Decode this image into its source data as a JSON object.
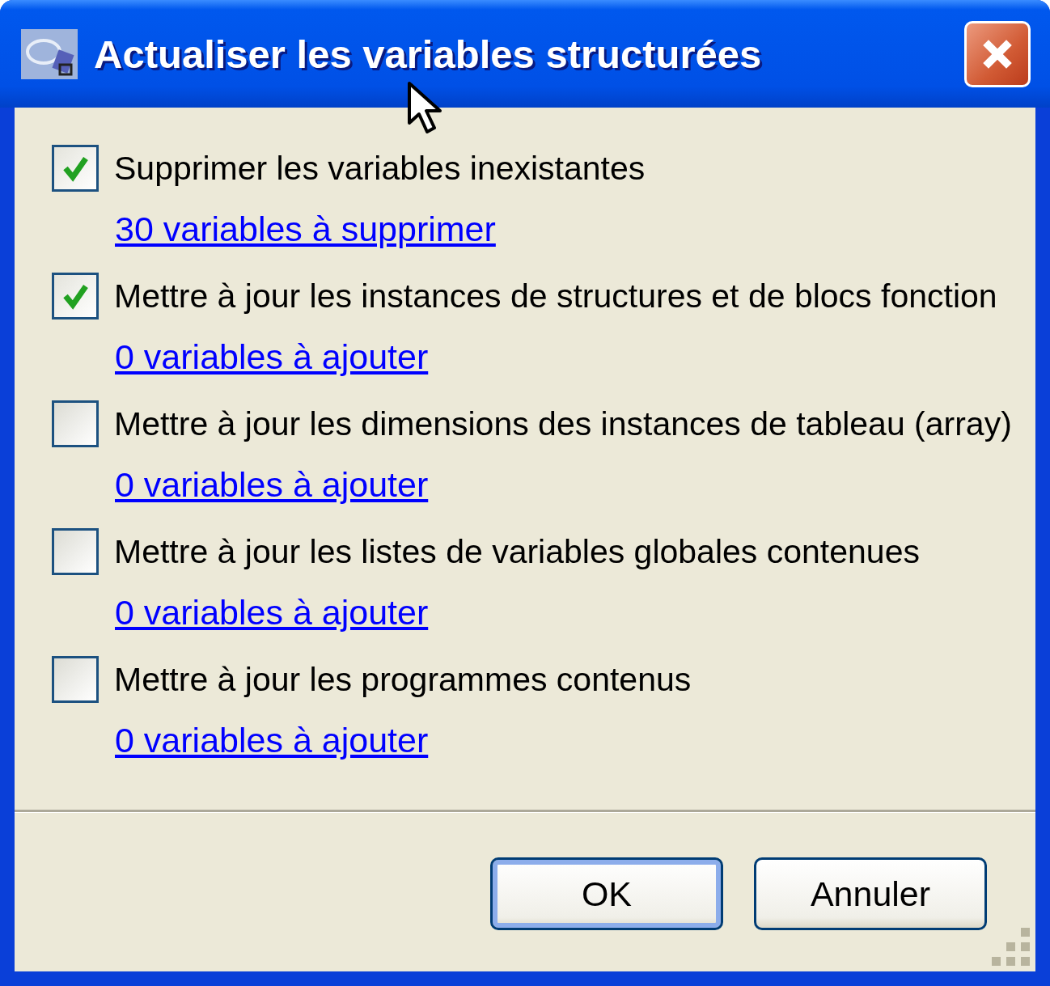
{
  "window": {
    "title": "Actualiser les variables structurées"
  },
  "options": [
    {
      "label": "Supprimer les variables inexistantes",
      "checked": true,
      "link": "30 variables à supprimer"
    },
    {
      "label": "Mettre à jour les instances de structures et de blocs fonction",
      "checked": true,
      "link": "0 variables à ajouter"
    },
    {
      "label": "Mettre à jour les dimensions des instances de tableau (array)",
      "checked": false,
      "link": "0 variables à ajouter"
    },
    {
      "label": "Mettre à jour les listes de variables globales contenues",
      "checked": false,
      "link": "0 variables à ajouter"
    },
    {
      "label": "Mettre à jour les programmes contenus",
      "checked": false,
      "link": "0 variables à ajouter"
    }
  ],
  "buttons": [
    {
      "label": "OK",
      "default": true
    },
    {
      "label": "Annuler",
      "default": false
    }
  ]
}
